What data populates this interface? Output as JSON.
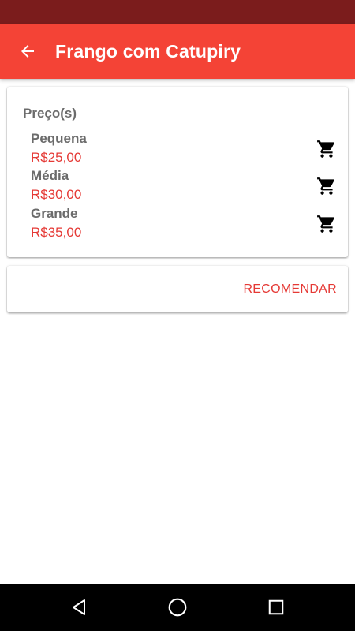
{
  "app_bar": {
    "title": "Frango com Catupiry",
    "back_icon": "arrow-back-icon",
    "color": "#f44336"
  },
  "status_bar": {
    "color": "#7b1c1c"
  },
  "prices": {
    "title": "Preço(s)",
    "items": [
      {
        "size": "Pequena",
        "price": "R$25,00",
        "icon": "cart-icon"
      },
      {
        "size": "Média",
        "price": "R$30,00",
        "icon": "cart-icon"
      },
      {
        "size": "Grande",
        "price": "R$35,00",
        "icon": "cart-icon"
      }
    ]
  },
  "recommend": {
    "label": "RECOMENDAR",
    "color": "#e53935"
  },
  "nav_bar": {
    "icons": [
      "nav-back-icon",
      "nav-home-icon",
      "nav-recents-icon"
    ]
  }
}
